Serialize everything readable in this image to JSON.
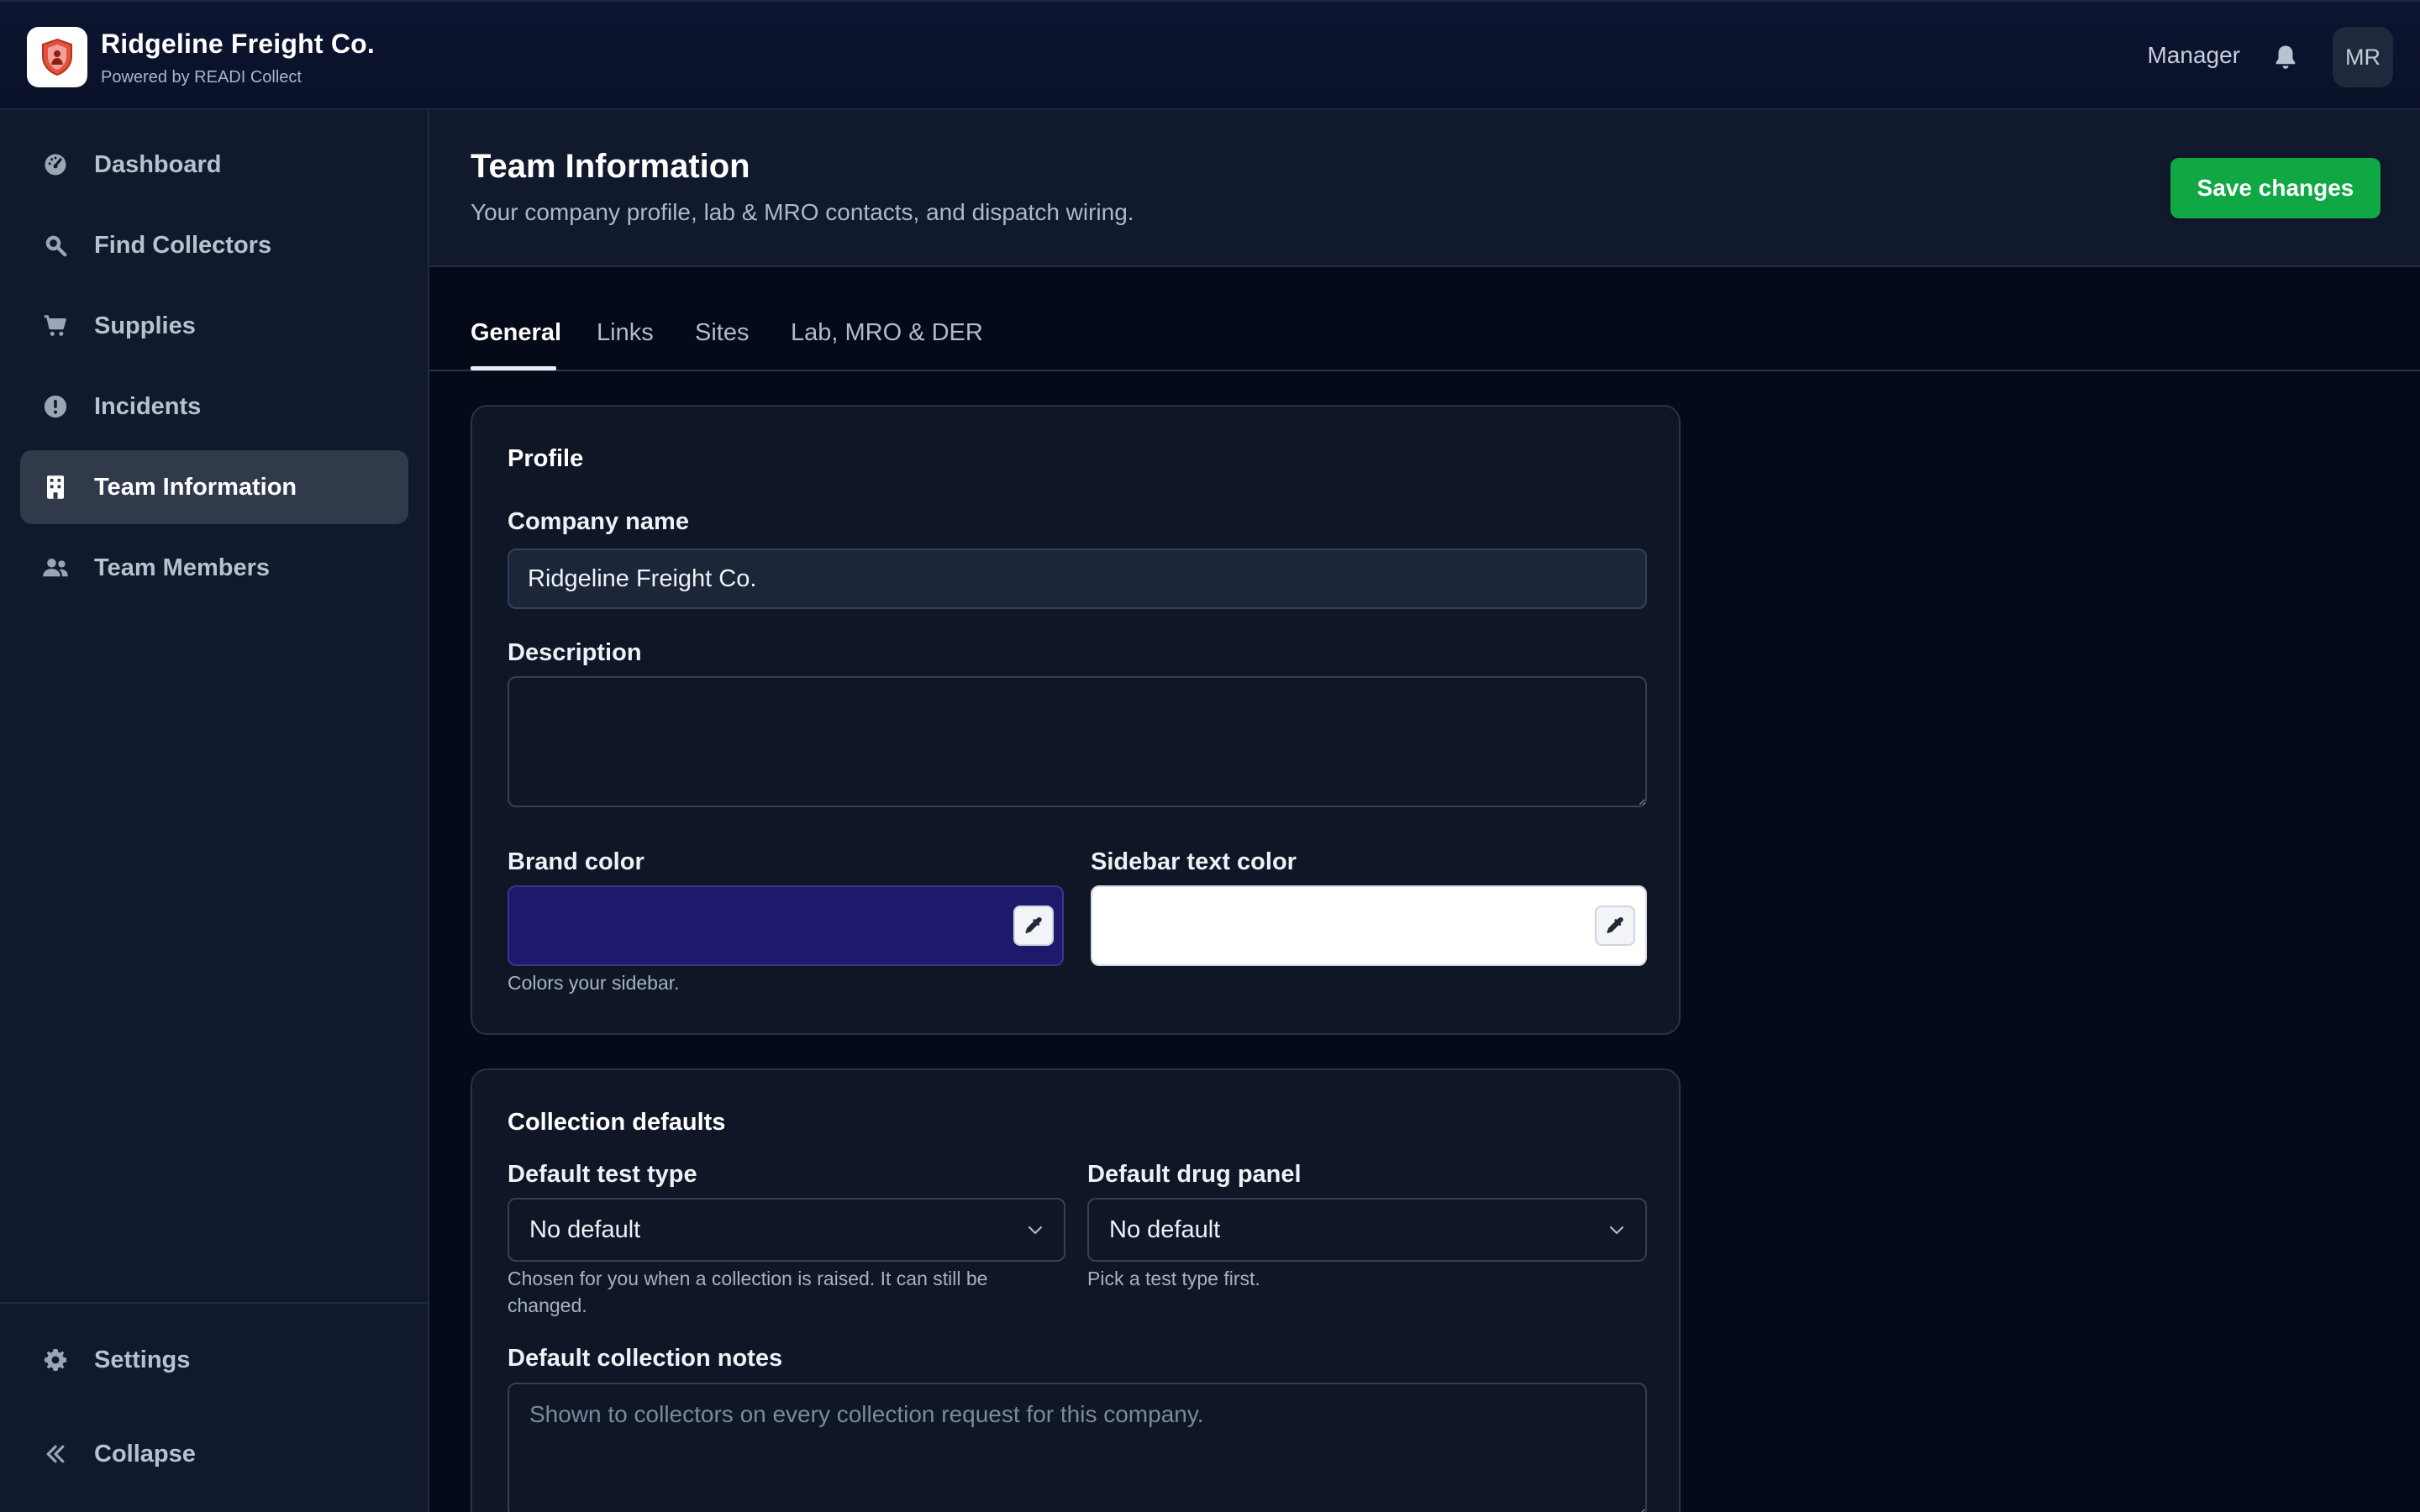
{
  "app": {
    "company": "Ridgeline Freight Co.",
    "powered_by": "Powered by READI Collect",
    "role": "Manager",
    "avatar_initials": "MR",
    "logo_icon": "shield-logo-icon"
  },
  "sidebar": {
    "items": [
      {
        "label": "Dashboard",
        "icon": "gauge-icon",
        "active": false
      },
      {
        "label": "Find Collectors",
        "icon": "search-icon",
        "active": false
      },
      {
        "label": "Supplies",
        "icon": "cart-icon",
        "active": false
      },
      {
        "label": "Incidents",
        "icon": "alert-icon",
        "active": false
      },
      {
        "label": "Team Information",
        "icon": "building-icon",
        "active": true
      },
      {
        "label": "Team Members",
        "icon": "users-icon",
        "active": false
      }
    ],
    "footer": [
      {
        "label": "Settings",
        "icon": "gear-icon"
      },
      {
        "label": "Collapse",
        "icon": "double-chevron-left-icon"
      }
    ]
  },
  "header": {
    "title": "Team Information",
    "subtitle": "Your company profile, lab & MRO contacts, and dispatch wiring.",
    "save_label": "Save changes"
  },
  "tabs": [
    {
      "label": "General",
      "active": true
    },
    {
      "label": "Links",
      "active": false
    },
    {
      "label": "Sites",
      "active": false
    },
    {
      "label": "Lab, MRO & DER",
      "active": false
    }
  ],
  "profile": {
    "title": "Profile",
    "company_name_label": "Company name",
    "company_name_value": "Ridgeline Freight Co.",
    "description_label": "Description",
    "description_value": "",
    "brand_color_label": "Brand color",
    "brand_color_value": "#1e1a6b",
    "brand_color_hint": "Colors your sidebar.",
    "sidebar_text_color_label": "Sidebar text color",
    "sidebar_text_color_value": "#ffffff"
  },
  "collection_defaults": {
    "title": "Collection defaults",
    "test_type_label": "Default test type",
    "test_type_value": "No default",
    "test_type_hint": "Chosen for you when a collection is raised. It can still be changed.",
    "drug_panel_label": "Default drug panel",
    "drug_panel_value": "No default",
    "drug_panel_hint": "Pick a test type first.",
    "notes_label": "Default collection notes",
    "notes_placeholder": "Shown to collectors on every collection request for this company."
  },
  "colors": {
    "save_button": "#0fa844",
    "background": "#050a19",
    "sidebar": "#111a2c",
    "active_nav": "#313a4b"
  }
}
